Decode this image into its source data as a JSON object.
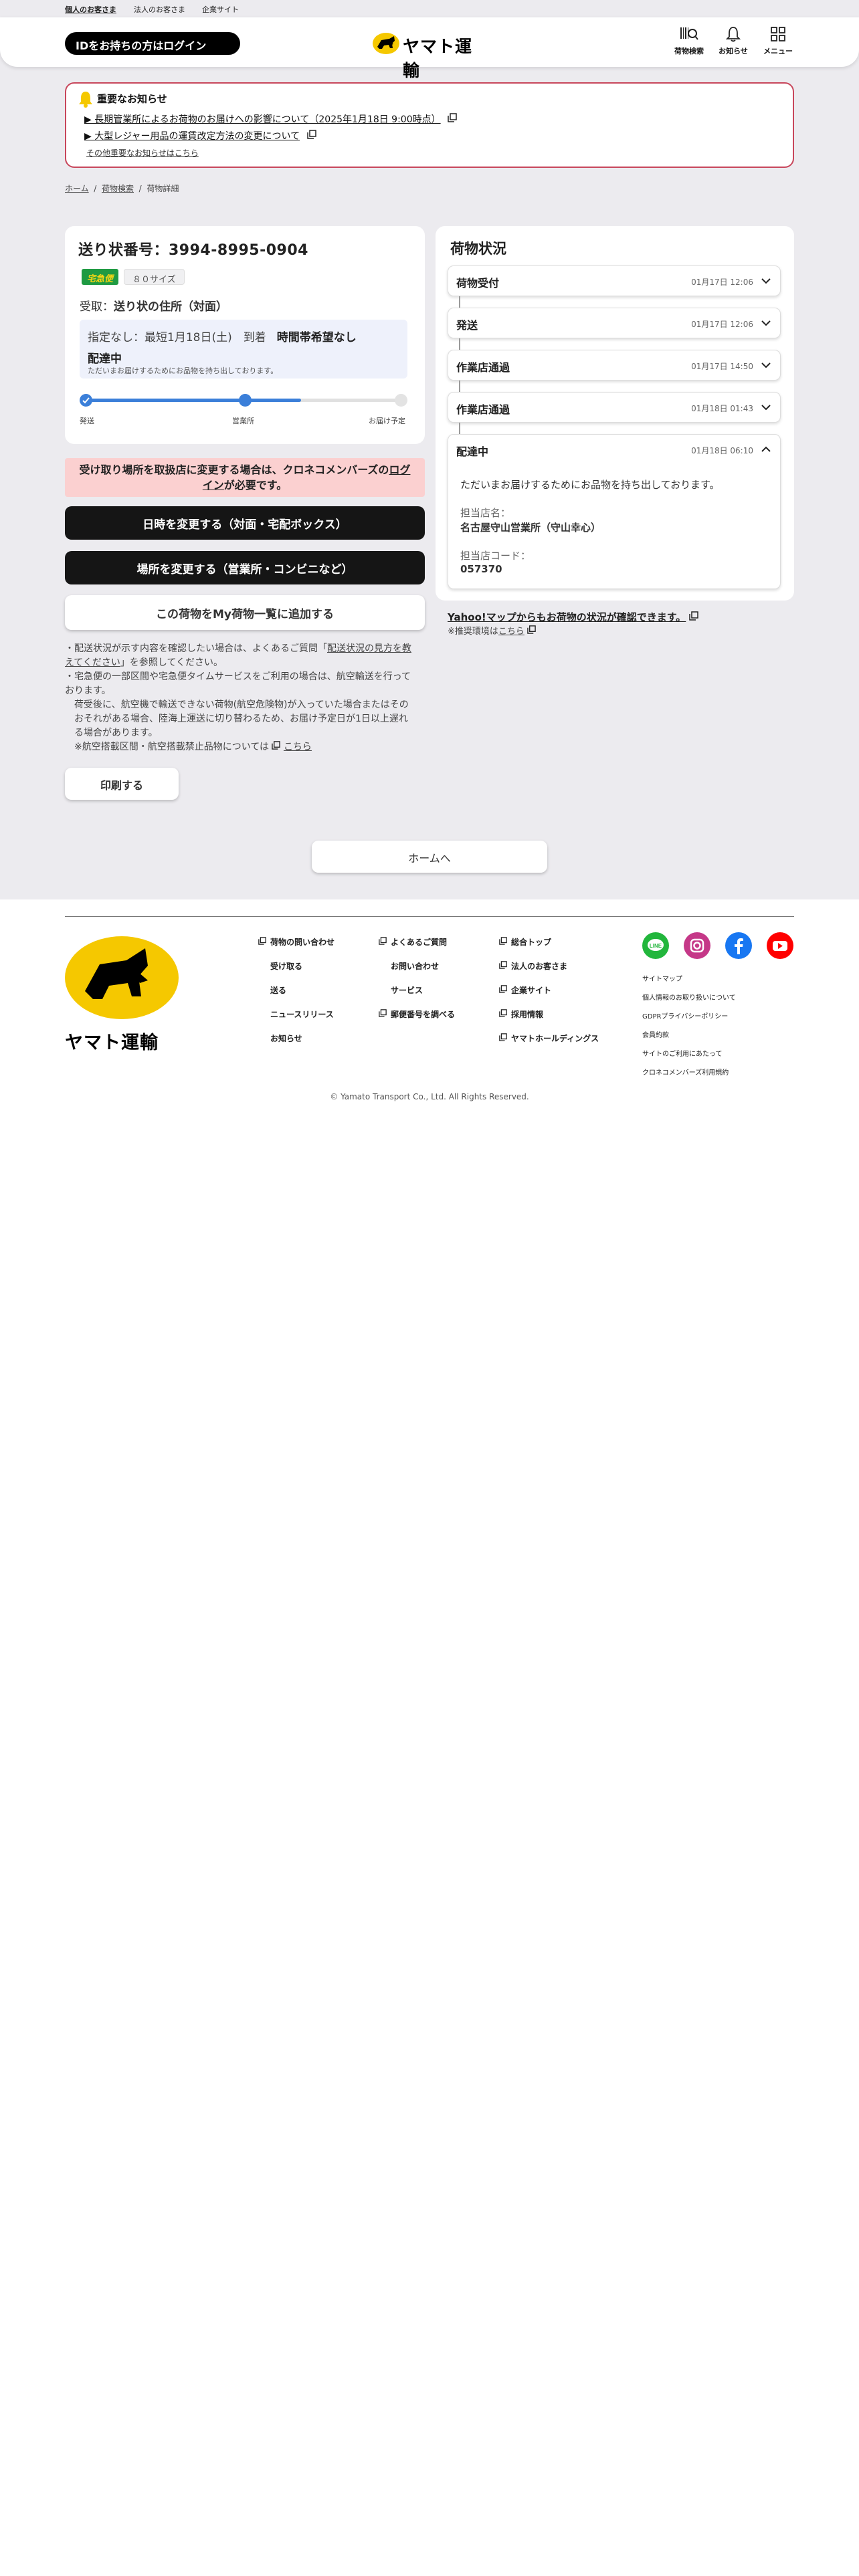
{
  "topnav": [
    "個人のお客さま",
    "法人のお客さま",
    "企業サイト"
  ],
  "header": {
    "login": "IDをお持ちの方はログイン",
    "logo_text": "ヤマト運輸",
    "icons": [
      {
        "label": "荷物検索",
        "icon": "package-search-icon"
      },
      {
        "label": "お知らせ",
        "icon": "bell-icon"
      },
      {
        "label": "メニュー",
        "icon": "grid-menu-icon"
      }
    ]
  },
  "notice": {
    "title": "重要なお知らせ",
    "items": [
      "▶ 長期管業所によるお荷物のお届けへの影響について（2025年1月18日 9:00時点）",
      "▶ 大型レジャー用品の運賃改定方法の変更について"
    ],
    "more": "その他重要なお知らせはこちら"
  },
  "breadcrumb": [
    "ホーム",
    "荷物検索",
    "荷物詳細"
  ],
  "shipment": {
    "tracking_label": "送り状番号：3994-8995-0904",
    "service_badge": "宅急便",
    "size_badge": "８０サイズ",
    "receive_prefix": "受取：",
    "receive_value": "送り状の住所（対面）",
    "delivery_line": "指定なし：最短1月18日(土)　到着",
    "time_line": "時間帯希望なし",
    "status": "配達中",
    "status_detail": "ただいまお届けするためにお品物を持ち出しております。",
    "progress": {
      "value_percent": 68,
      "steps": [
        "発送",
        "営業所",
        "お届け予定"
      ]
    }
  },
  "warning": {
    "text_before": "受け取り場所を取扱店に変更する場合は、クロネコメンバーズの",
    "link": "ログイン",
    "text_after": "が必要です。"
  },
  "buttons": {
    "change_datetime": "日時を変更する（対面・宅配ボックス）",
    "change_place": "場所を変更する（営業所・コンビニなど）",
    "add_my_list": "この荷物をMy荷物一覧に追加する",
    "print": "印刷する",
    "home": "ホームへ"
  },
  "notes": {
    "n1a": "・配送状況が示す内容を確認したい場合は、よくあるご質問「",
    "n1link": "配送状況の見方を教えてください",
    "n1b": "」を参照してください。",
    "n2": "・宅急便の一部区間や宅急便タイムサービスをご利用の場合は、航空輸送を行っております。",
    "n3": "荷受後に、航空機で輸送できない荷物(航空危険物)が入っていた場合またはそのおそれがある場合、陸海上運送に切り替わるため、お届け予定日が1日以上遅れる場合があります。",
    "n4": "※航空搭載区間・航空搭載禁止品物については",
    "n4link": "こちら"
  },
  "status_panel": {
    "title": "荷物状況",
    "steps": [
      {
        "name": "荷物受付",
        "time": "01月17日 12:06"
      },
      {
        "name": "発送",
        "time": "01月17日 12:06"
      },
      {
        "name": "作業店通過",
        "time": "01月17日 14:50"
      },
      {
        "name": "作業店通過",
        "time": "01月18日 01:43"
      },
      {
        "name": "配達中",
        "time": "01月18日 06:10"
      }
    ],
    "expanded": {
      "message": "ただいまお届けするためにお品物を持ち出しております。",
      "office_label": "担当店名：",
      "office_value": "名古屋守山営業所（守山幸心）",
      "code_label": "担当店コード：",
      "code_value": "057370"
    }
  },
  "yahoo": {
    "link": "Yahoo!マップからもお荷物の状況が確認できます。",
    "env_prefix": "※推奨環境は",
    "env_link": "こちら"
  },
  "footer": {
    "logo_text": "ヤマト運輸",
    "col1": [
      "荷物の問い合わせ",
      "受け取る",
      "送る",
      "ニュースリリース",
      "お知らせ"
    ],
    "col2": [
      "よくあるご質問",
      "お問い合わせ",
      "サービス",
      "郵便番号を調べる"
    ],
    "col3": [
      "総合トップ",
      "法人のお客さま",
      "企業サイト",
      "採用情報",
      "ヤマトホールディングス"
    ],
    "small": [
      "サイトマップ",
      "個人情報のお取り扱いについて",
      "GDPRプライバシーポリシー",
      "会員約款",
      "サイトのご利用にあたって",
      "クロネコメンバーズ利用規約"
    ],
    "social": [
      {
        "name": "line-icon",
        "color": "#22b63c"
      },
      {
        "name": "instagram-icon",
        "color": "#c53888"
      },
      {
        "name": "facebook-icon",
        "color": "#1877f2"
      },
      {
        "name": "youtube-icon",
        "color": "#ff0000"
      }
    ],
    "copyright": "© Yamato Transport Co., Ltd. All Rights Reserved."
  },
  "colors": {
    "brand_yellow": "#f5c800",
    "dark_button": "#151515",
    "progress_blue": "#3b7fd9",
    "warning_pink": "#fbd0d0",
    "notice_border": "#c8475c"
  }
}
